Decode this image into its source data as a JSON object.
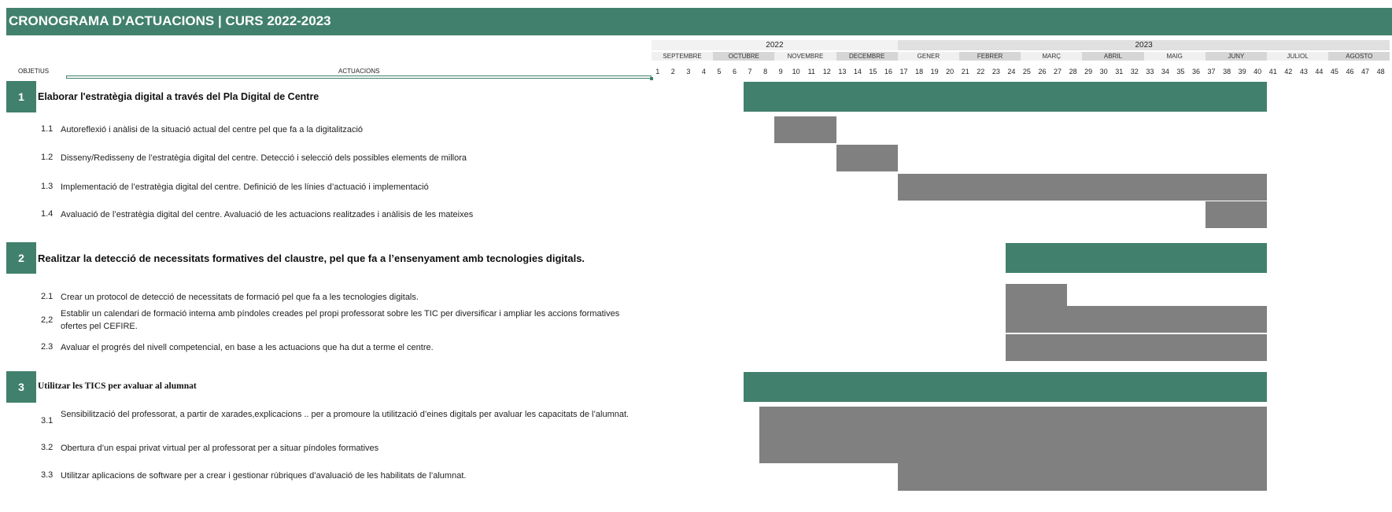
{
  "title": "CRONOGRAMA D'ACTUACIONS | CURS 2022-2023",
  "years": [
    {
      "label": "2022",
      "from_week": 1,
      "to_week": 16
    },
    {
      "label": "2023",
      "from_week": 17,
      "to_week": 48
    }
  ],
  "months": [
    "SEPTEMBRE",
    "OCTUBRE",
    "NOVEMBRE",
    "DECEMBRE",
    "GENER",
    "FEBRER",
    "MARÇ",
    "ABRIL",
    "MAIG",
    "JUNY",
    "JULIOL",
    "AGOSTO"
  ],
  "headers": {
    "objectives": "OBJETIUS",
    "actions": "ACTUACIONS"
  },
  "colors": {
    "objective": "#41806c",
    "action": "#808080",
    "header": "#41806c"
  },
  "chart_data": {
    "type": "gantt",
    "x_unit": "week",
    "x_range": [
      1,
      48
    ],
    "objectives": [
      {
        "num": "1",
        "title": "Elaborar l'estratègia digital a través del Pla Digital de Centre",
        "start": 7,
        "end": 40,
        "actions": [
          {
            "num": "1.1",
            "text": "Autoreflexió i anàlisi de la situació actual del centre pel que fa a la digitalització",
            "start": 9,
            "end": 12
          },
          {
            "num": "1.2",
            "text": "Disseny/Redisseny de l’estratègia digital del centre. Detecció i selecció dels possibles elements de millora",
            "start": 13,
            "end": 16
          },
          {
            "num": "1.3",
            "text": "Implementació de l’estratègia digital del centre. Definició de les línies d’actuació i implementació",
            "start": 17,
            "end": 40
          },
          {
            "num": "1.4",
            "text": "Avaluació de l’estratègia digital del centre. Avaluació de les actuacions realitzades i anàlisis de les mateixes",
            "start": 37,
            "end": 40
          }
        ]
      },
      {
        "num": "2",
        "title": "Realitzar la detecció de necessitats formatives del claustre, pel que fa a l’ensenyament amb tecnologies digitals.",
        "start": 24,
        "end": 40,
        "actions": [
          {
            "num": "2.1",
            "text": "Crear un protocol de detecció de necessitats de formació pel que fa a les tecnologies digitals.",
            "start": 24,
            "end": 27
          },
          {
            "num": "2,2",
            "text": "Establir un calendari de formació interna amb píndoles creades pel propi professorat sobre les TIC per diversificar i ampliar les accions formatives ofertes pel CEFIRE.",
            "start": 24,
            "end": 40
          },
          {
            "num": "2.3",
            "text": "Avaluar el progrés del nivell competencial, en base a les actuacions que ha dut a terme el centre.",
            "start": 24,
            "end": 40
          }
        ]
      },
      {
        "num": "3",
        "title": "Utilitzar les TICS per avaluar al alumnat",
        "start": 7,
        "end": 40,
        "actions": [
          {
            "num": "3.1",
            "text": "Sensibilització del professorat, a partir de xarades,explicacions .. per a promoure la utilització d’eines digitals per avaluar les capacitats de l’alumnat.",
            "start": 8,
            "end": 40
          },
          {
            "num": "3.2",
            "text": "Obertura d’un espai privat virtual per al professorat per a situar píndoles formatives",
            "start": 8,
            "end": 40
          },
          {
            "num": "3.3",
            "text": "Utilitzar aplicacions de software per a crear i gestionar rúbriques d’avaluació de les habilitats de l’alumnat.",
            "start": 17,
            "end": 40
          }
        ]
      }
    ]
  }
}
